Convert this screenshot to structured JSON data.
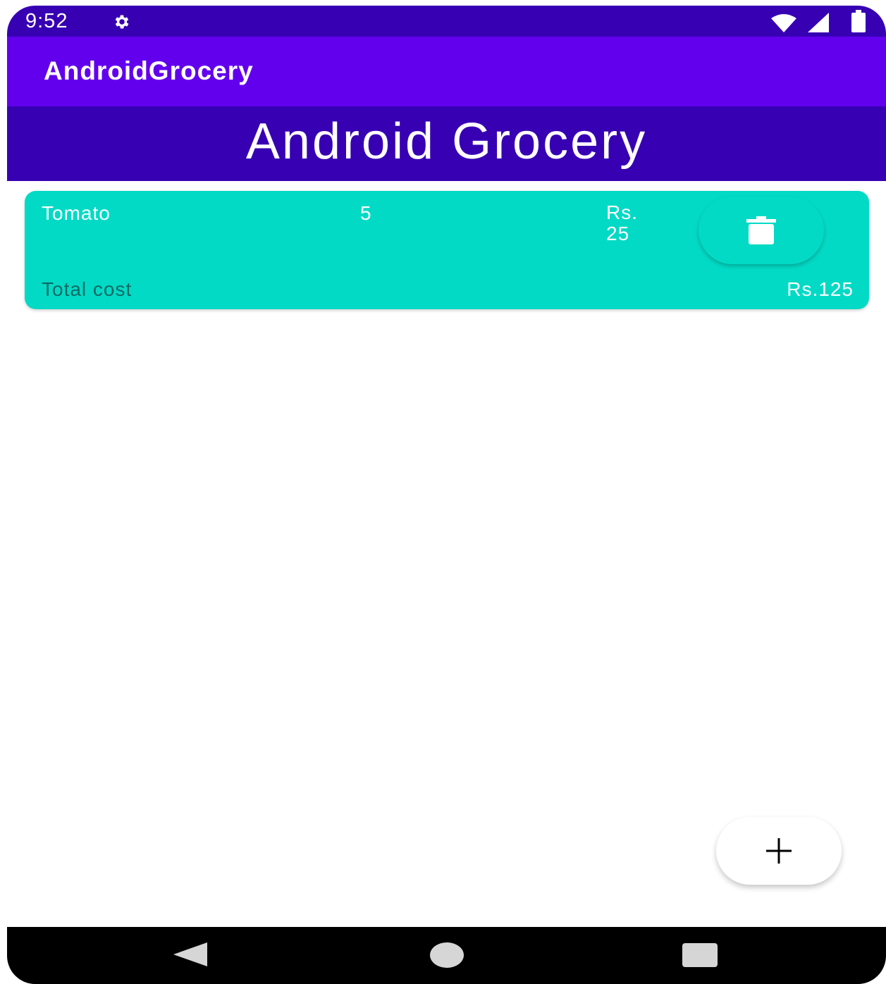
{
  "status_bar": {
    "time": "9:52",
    "icons": [
      "gear-icon",
      "wifi-icon",
      "signal-icon",
      "battery-icon"
    ]
  },
  "app_bar": {
    "title": "AndroidGrocery"
  },
  "banner": {
    "title": "Android Grocery"
  },
  "items": [
    {
      "name": "Tomato",
      "quantity": "5",
      "price": "Rs. 25",
      "total_label": "Total cost",
      "total_value": "Rs.125",
      "delete_icon": "trash-icon"
    }
  ],
  "fab": {
    "icon": "plus-icon"
  },
  "nav_bar": {
    "icons": [
      "back-icon",
      "home-icon",
      "recents-icon"
    ]
  },
  "colors": {
    "status_bar": "#3700B3",
    "app_bar": "#6200EE",
    "banner": "#3700B3",
    "card": "#03DAC5",
    "total_label": "#0A6B63",
    "nav_bar": "#000000"
  }
}
